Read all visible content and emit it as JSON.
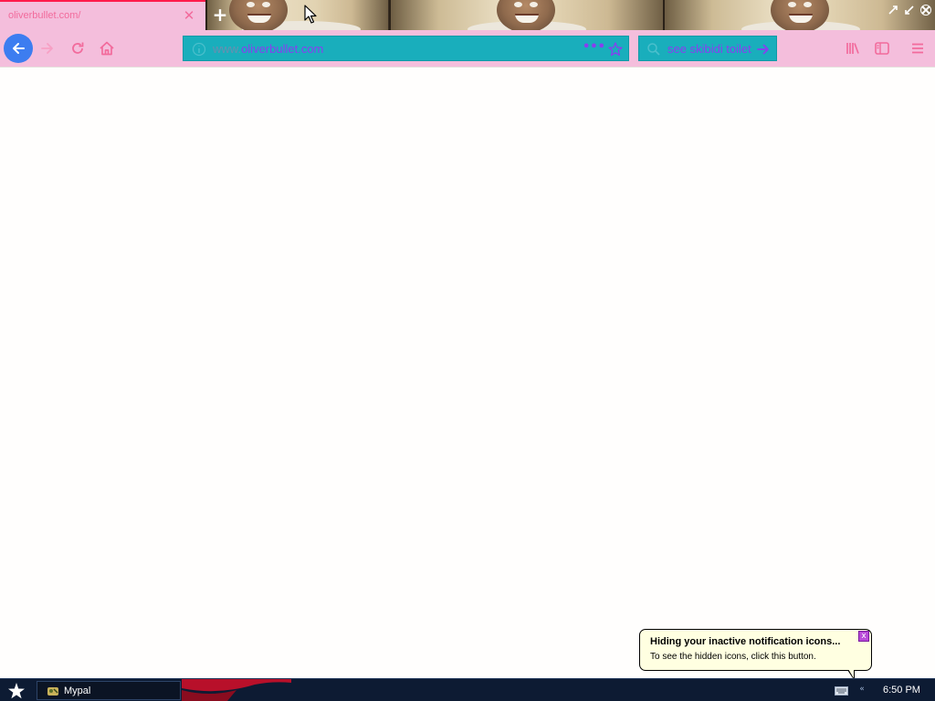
{
  "browser": {
    "tab": {
      "title": "oliverbullet.com/",
      "close_icon": "close-icon"
    },
    "new_tab_label": "+",
    "window_controls": [
      "minimize-icon",
      "maximize-icon",
      "close-window-icon"
    ],
    "nav": {
      "back_icon": "arrow-left-icon",
      "forward_icon": "arrow-right-icon",
      "reload_icon": "reload-icon",
      "home_icon": "home-icon"
    },
    "urlbar": {
      "prefix": "www.",
      "domain": "oliverbullet.com",
      "more_label": "•••",
      "bookmark_icon": "star-icon"
    },
    "searchbar": {
      "value": "see skibidi toilet",
      "go_icon": "arrow-right-icon"
    },
    "toolbar_icons": [
      "library-icon",
      "sidebar-icon",
      "menu-icon"
    ]
  },
  "notification": {
    "title": "Hiding your inactive notification icons...",
    "body": "To see the hidden icons, click this button.",
    "close_label": "x"
  },
  "taskbar": {
    "start_icon": "star-icon",
    "task": {
      "label": "Mypal"
    },
    "tray": {
      "keyboard_icon": "keyboard-icon",
      "chevron": "«"
    },
    "clock": "6:50 PM"
  },
  "colors": {
    "toolbar_bg": "#f4bedc",
    "urlbar_bg": "#19aebc",
    "url_text": "#8a3df0",
    "back_button": "#3d7df0",
    "accent_red": "#ff1a4a",
    "taskbar_bg": "#0d1b33",
    "balloon_bg": "#ffffe1"
  }
}
